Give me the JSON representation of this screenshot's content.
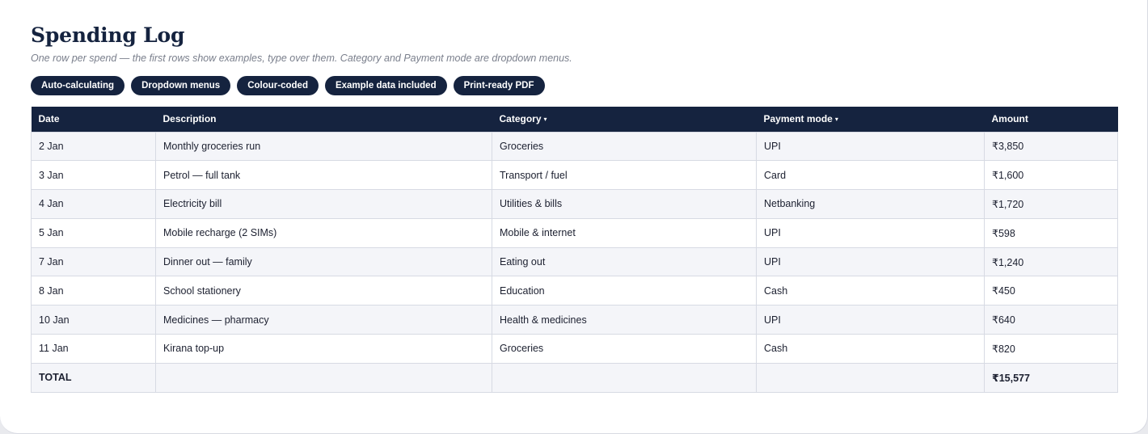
{
  "header": {
    "title": "Spending Log",
    "subtitle": "One row per spend — the first rows show examples, type over them. Category and Payment mode are dropdown menus."
  },
  "badges": [
    "Auto-calculating",
    "Dropdown menus",
    "Colour-coded",
    "Example data included",
    "Print-ready PDF"
  ],
  "table": {
    "columns": [
      "Date",
      "Description",
      "Category",
      "Payment mode",
      "Amount"
    ],
    "dropdown_caret": "▾",
    "rows": [
      {
        "date": "2 Jan",
        "description": "Monthly groceries run",
        "category": "Groceries",
        "payment": "UPI",
        "amount": "₹3,850"
      },
      {
        "date": "3 Jan",
        "description": "Petrol — full tank",
        "category": "Transport / fuel",
        "payment": "Card",
        "amount": "₹1,600"
      },
      {
        "date": "4 Jan",
        "description": "Electricity bill",
        "category": "Utilities & bills",
        "payment": "Netbanking",
        "amount": "₹1,720"
      },
      {
        "date": "5 Jan",
        "description": "Mobile recharge (2 SIMs)",
        "category": "Mobile & internet",
        "payment": "UPI",
        "amount": "₹598"
      },
      {
        "date": "7 Jan",
        "description": "Dinner out — family",
        "category": "Eating out",
        "payment": "UPI",
        "amount": "₹1,240"
      },
      {
        "date": "8 Jan",
        "description": "School stationery",
        "category": "Education",
        "payment": "Cash",
        "amount": "₹450"
      },
      {
        "date": "10 Jan",
        "description": "Medicines — pharmacy",
        "category": "Health & medicines",
        "payment": "UPI",
        "amount": "₹640"
      },
      {
        "date": "11 Jan",
        "description": "Kirana top-up",
        "category": "Groceries",
        "payment": "Cash",
        "amount": "₹820"
      }
    ],
    "total": {
      "label": "TOTAL",
      "amount": "₹15,577"
    }
  },
  "colors": {
    "navy": "#15233f",
    "row_alt": "#f4f5f9",
    "border": "#d7dae3"
  }
}
